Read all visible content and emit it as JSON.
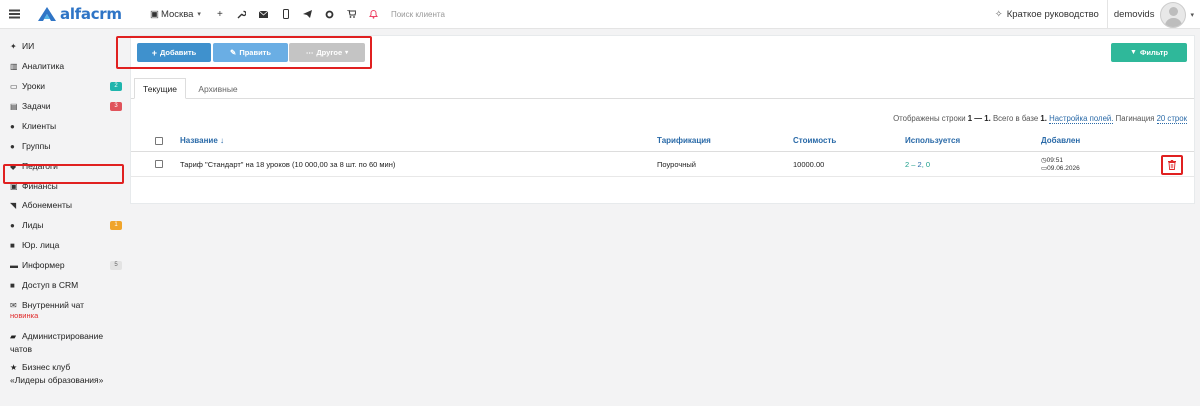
{
  "brand": {
    "name": "alfacrm",
    "color": "#2f75c6"
  },
  "topbar": {
    "city": "Москва",
    "city_caret": "▾",
    "icons": [
      "plus-icon",
      "wrench-icon",
      "mail-icon",
      "mobile-icon",
      "telegram-icon",
      "gear-icon",
      "cart-icon",
      "bell-icon"
    ],
    "search_placeholder": "Поиск клиента",
    "guide_label": "Краткое руководство",
    "username": "demovids"
  },
  "sidebar": {
    "items": [
      {
        "label": "ИИ",
        "icon": "sparkle-icon"
      },
      {
        "label": "Аналитика",
        "icon": "chart-icon"
      },
      {
        "label": "Уроки",
        "icon": "calendar-icon",
        "badge": "2"
      },
      {
        "label": "Задачи",
        "icon": "tasks-icon",
        "badge": "3"
      },
      {
        "label": "Клиенты",
        "icon": "user-icon"
      },
      {
        "label": "Группы",
        "icon": "users-icon"
      },
      {
        "label": "Педагоги",
        "icon": "graduation-icon"
      },
      {
        "label": "Финансы",
        "icon": "money-icon"
      },
      {
        "label": "Абонементы",
        "icon": "tag-icon"
      },
      {
        "label": "Лиды",
        "icon": "user-plus-icon",
        "badge": "1"
      },
      {
        "label": "Юр. лица",
        "icon": "briefcase-icon"
      },
      {
        "label": "Информер",
        "icon": "card-icon",
        "badge": "5"
      },
      {
        "label": "Доступ в CRM",
        "icon": "lock-icon"
      },
      {
        "label": "Внутренний чат",
        "icon": "mail-icon",
        "sub": "новинка"
      },
      {
        "label": "Администрирование",
        "label2": "чатов",
        "icon": "chat-icon"
      },
      {
        "label": "Бизнес клуб",
        "label2": "«Лидеры образования»",
        "icon": "star-icon"
      }
    ]
  },
  "toolbar": {
    "add_label": "Добавить",
    "edit_label": "Править",
    "other_label": "Другое",
    "filter_label": "Фильтр"
  },
  "tabs": [
    {
      "label": "Текущие",
      "active": true
    },
    {
      "label": "Архивные",
      "active": false
    }
  ],
  "pager": {
    "prefix": "Отображены строки",
    "range": "1 — 1.",
    "total_prefix": "Всего в базе",
    "total": "1.",
    "settings_link": "Настройка полей.",
    "pagination_label": "Пагинация",
    "pagination_value": "20 строк"
  },
  "table": {
    "columns": [
      "Название ↓",
      "Тарификация",
      "Стоимость",
      "Используется",
      "Добавлен"
    ],
    "rows": [
      {
        "name": "Тариф \"Стандарт\" на 18 уроков (10 000,00 за 8 шт. по 60 мин)",
        "billing": "Поурочный",
        "price": "10000.00",
        "used_a": "2",
        "used_sep": " – ",
        "used_b": "2",
        "used_c": ", 0",
        "time": "09:51",
        "date": "09.06.2026"
      }
    ]
  }
}
